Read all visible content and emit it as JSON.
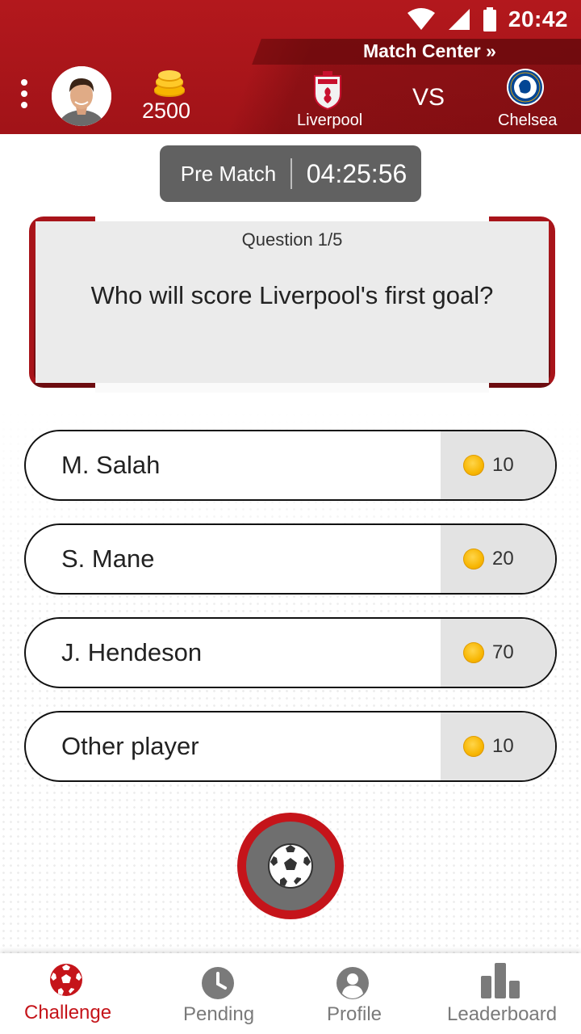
{
  "status_bar": {
    "time": "20:42"
  },
  "header": {
    "match_center_label": "Match Center »",
    "coins": "2500",
    "home_team": "Liverpool",
    "away_team": "Chelsea",
    "vs_label": "VS"
  },
  "timer": {
    "phase": "Pre Match",
    "countdown": "04:25:56"
  },
  "question": {
    "number": "Question 1/5",
    "text": "Who will score Liverpool's first goal?"
  },
  "answers": [
    {
      "label": "M. Salah",
      "points": "10"
    },
    {
      "label": "S. Mane",
      "points": "20"
    },
    {
      "label": "J. Hendeson",
      "points": "70"
    },
    {
      "label": "Other player",
      "points": "10"
    }
  ],
  "nav": {
    "items": [
      {
        "label": "Challenge",
        "icon": "soccer-ball-icon",
        "active": true
      },
      {
        "label": "Pending",
        "icon": "clock-icon",
        "active": false
      },
      {
        "label": "Profile",
        "icon": "person-icon",
        "active": false
      },
      {
        "label": "Leaderboard",
        "icon": "bar-chart-icon",
        "active": false
      }
    ]
  },
  "colors": {
    "primary_red": "#b3181d",
    "dark_gray": "#616161",
    "coin_gold": "#f7b500",
    "inactive": "#7a7a7a"
  }
}
